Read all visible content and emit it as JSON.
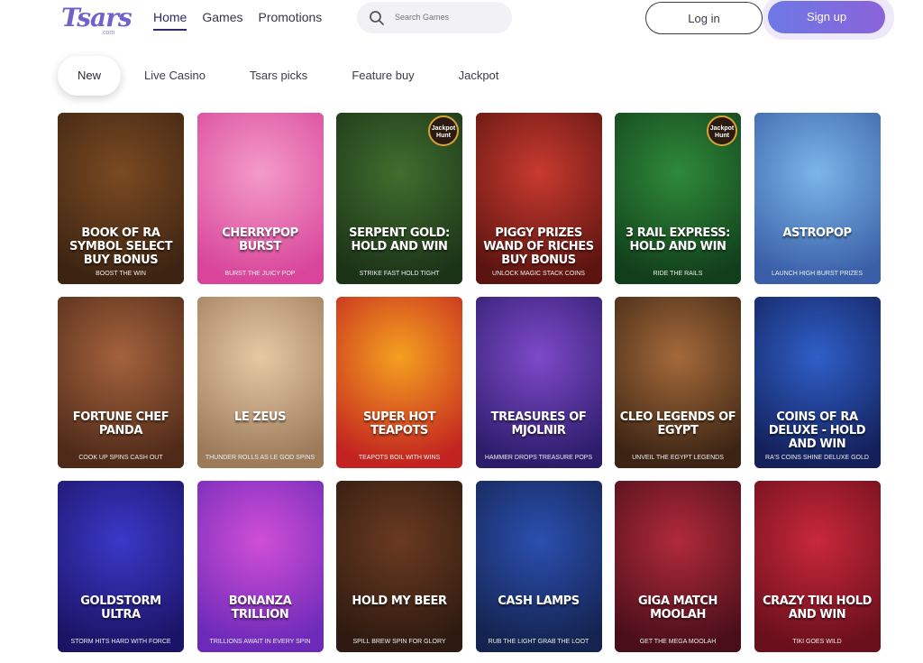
{
  "header": {
    "logo_text": "Tsars",
    "logo_sub": ".com",
    "nav": [
      "Home",
      "Games",
      "Promotions"
    ],
    "search_placeholder": "Search Games",
    "login_label": "Log in",
    "signup_label": "Sign up"
  },
  "categories": [
    "New",
    "Live Casino",
    "Tsars picks",
    "Feature buy",
    "Jackpot"
  ],
  "games": [
    {
      "title": "Book of Ra Symbol Select Buy Bonus",
      "tag": "Boost the win",
      "color1": "#7a4a22",
      "color2": "#3d2412",
      "jackpot": false
    },
    {
      "title": "CherryPop Burst",
      "tag": "Burst the juicy pop",
      "color1": "#f49bc9",
      "color2": "#d8459a",
      "jackpot": false
    },
    {
      "title": "Serpent Gold: Hold and Win",
      "tag": "Strike fast hold tight",
      "color1": "#3f6e2e",
      "color2": "#1c3318",
      "jackpot": true
    },
    {
      "title": "Piggy Prizes Wand of Riches Buy Bonus",
      "tag": "Unlock magic stack coins",
      "color1": "#c83a2f",
      "color2": "#5c1410",
      "jackpot": false
    },
    {
      "title": "3 Rail Express: Hold and Win",
      "tag": "Ride the rails",
      "color1": "#2f8a3a",
      "color2": "#123f1b",
      "jackpot": true
    },
    {
      "title": "Astropop",
      "tag": "Launch high burst prizes",
      "color1": "#7ab6e8",
      "color2": "#3a5fa8",
      "jackpot": false
    },
    {
      "title": "Fortune Chef Panda",
      "tag": "Cook up spins cash out",
      "color1": "#a4623d",
      "color2": "#4f2a18",
      "jackpot": false
    },
    {
      "title": "Le Zeus",
      "tag": "Thunder rolls as le god spins",
      "color1": "#e7c9a4",
      "color2": "#9c7a5a",
      "jackpot": false
    },
    {
      "title": "Super Hot Teapots",
      "tag": "Teapots boil with wins",
      "color1": "#f5a020",
      "color2": "#c22320",
      "jackpot": false
    },
    {
      "title": "Treasures of Mjolnir",
      "tag": "Hammer drops treasure pops",
      "color1": "#7e49c9",
      "color2": "#2c1d6b",
      "jackpot": false
    },
    {
      "title": "Cleo Legends of Egypt",
      "tag": "Unveil the Egypt legends",
      "color1": "#a46a3a",
      "color2": "#3b2414",
      "jackpot": false
    },
    {
      "title": "Coins of Ra Deluxe - Hold and Win",
      "tag": "Ra's coins shine deluxe gold",
      "color1": "#2f5fc8",
      "color2": "#13205a",
      "jackpot": false
    },
    {
      "title": "Goldstorm Ultra",
      "tag": "Storm hits hard with force",
      "color1": "#3b38c8",
      "color2": "#1b1466",
      "jackpot": false
    },
    {
      "title": "Bonanza Trillion",
      "tag": "Trillions await in every spin",
      "color1": "#d14ed6",
      "color2": "#6b2ab8",
      "jackpot": false
    },
    {
      "title": "Hold My Beer",
      "tag": "Spill brew spin for glory",
      "color1": "#6a3a20",
      "color2": "#2e1a10",
      "jackpot": false
    },
    {
      "title": "Cash Lamps",
      "tag": "Rub the light grab the loot",
      "color1": "#2b4fb0",
      "color2": "#14234f",
      "jackpot": false
    },
    {
      "title": "Giga Match Moolah",
      "tag": "Get the mega moolah",
      "color1": "#b02a3a",
      "color2": "#4a0e1a",
      "jackpot": false
    },
    {
      "title": "Crazy Tiki Hold and Win",
      "tag": "Tiki goes wild",
      "color1": "#c8283a",
      "color2": "#6a0f1c",
      "jackpot": false
    }
  ],
  "jackpot_badge": "Jackpot Hunt"
}
